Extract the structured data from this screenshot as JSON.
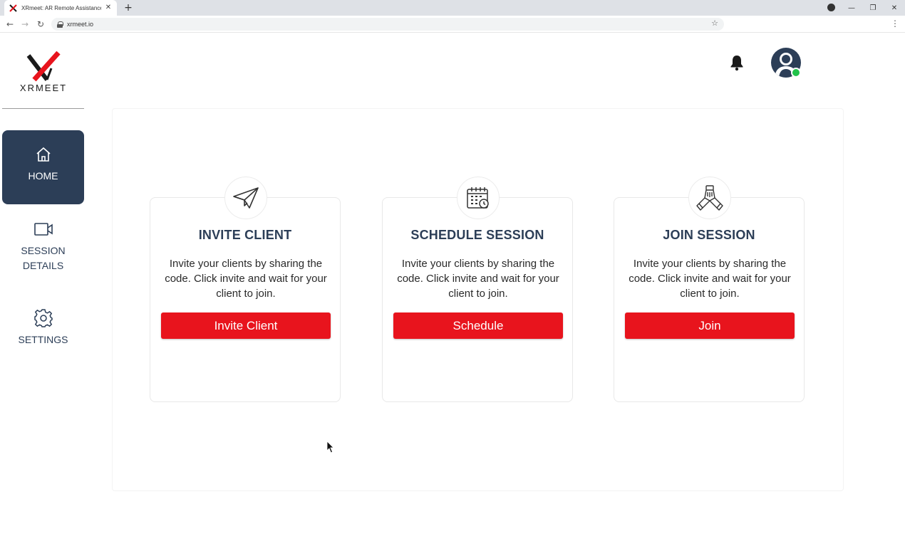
{
  "browser": {
    "tab_title": "XRmeet: AR Remote Assistance &",
    "tab_close": "✕",
    "new_tab": "+",
    "url": "xrmeet.io",
    "window_controls": {
      "minimize": "—",
      "restore": "❐",
      "close": "✕"
    },
    "nav": {
      "back": "←",
      "forward": "→",
      "reload": "↻"
    },
    "star": "☆",
    "menu": "⋮"
  },
  "sidebar": {
    "logo_text": "XRMEET",
    "items": [
      {
        "label": "HOME",
        "icon": "home-icon",
        "active": true
      },
      {
        "label": "SESSION DETAILS",
        "icon": "video-camera-icon",
        "active": false
      },
      {
        "label": "SETTINGS",
        "icon": "gear-icon",
        "active": false
      }
    ]
  },
  "header": {
    "notifications_icon": "bell-icon",
    "avatar_icon": "user-avatar-icon",
    "status": "online",
    "status_color": "#21c24a"
  },
  "cards": [
    {
      "title": "INVITE CLIENT",
      "icon": "paper-plane-icon",
      "description": "Invite your clients by sharing the code. Click invite and wait for your client to join.",
      "button": "Invite Client"
    },
    {
      "title": "SCHEDULE SESSION",
      "icon": "calendar-clock-icon",
      "description": "Invite your clients by sharing the code. Click invite and wait for your client to join.",
      "button": "Schedule"
    },
    {
      "title": "JOIN SESSION",
      "icon": "team-hands-icon",
      "description": "Invite your clients by sharing the code. Click invite and wait for your client to join.",
      "button": "Join"
    }
  ],
  "colors": {
    "primary_navy": "#2c3e57",
    "button_red": "#e8141d",
    "logo_red": "#e8141d"
  }
}
